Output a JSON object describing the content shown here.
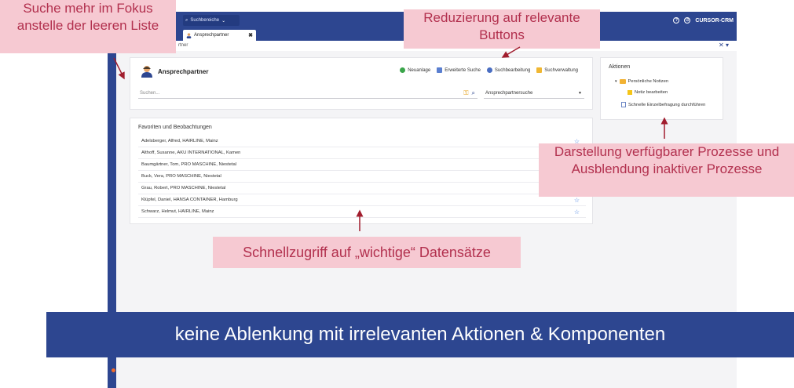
{
  "app": {
    "search_area_label": "Suchbereiche",
    "active_tab": "Ansprechpartner",
    "tab_close": "✖",
    "brand": "CURSOR-CRM",
    "breadcrumb": "rtner",
    "colors": {
      "primary": "#2d4690",
      "annotation_bg": "#f6c9d2",
      "annotation_text": "#b2304e",
      "favorite_star": "#3f7ce0"
    }
  },
  "search_panel": {
    "title": "Ansprechpartner",
    "toolbar": [
      {
        "label": "Neuanlage",
        "icon": "plus-circle-icon"
      },
      {
        "label": "Erweiterte Suche",
        "icon": "advanced-search-icon"
      },
      {
        "label": "Suchbearbeitung",
        "icon": "search-edit-icon"
      },
      {
        "label": "Suchverwaltung",
        "icon": "search-manage-icon"
      }
    ],
    "search_placeholder": "Suchen...",
    "search_type": "Ansprechpartnersuche"
  },
  "favorites": {
    "title": "Favoriten und Beobachtungen",
    "rows": [
      "Adelsberger, Alfred, HAIRLINE, Mainz",
      "Althoff, Susanne, AKU INTERNATIONAL, Kamen",
      "Baumgärtner, Tom, PRO MASCHINE, Niestetal",
      "Buck, Vera, PRO MASCHINE, Niestetal",
      "Grau, Robert, PRO MASCHINE, Niestetal",
      "Klüpfel, Daniel, HANSA CONTAINER, Hamburg",
      "Schwarz, Helmut, HAIRLINE, Mainz"
    ]
  },
  "actions": {
    "title": "Aktionen",
    "items": [
      "Persönliche Notizen",
      "Notiz bearbeiten",
      "Schnelle Einzelbefragung durchführen"
    ]
  },
  "annotations": {
    "top_left": "Suche mehr im Fokus anstelle der leeren Liste",
    "top_center": "Reduzierung auf relevante Buttons",
    "right": "Darstellung verfügbarer Prozesse und Ausblendung inaktiver Prozesse",
    "bottom": "Schnellzugriff auf „wichtige“ Datensätze",
    "banner": "keine Ablenkung mit irrelevanten Aktionen & Komponenten"
  }
}
